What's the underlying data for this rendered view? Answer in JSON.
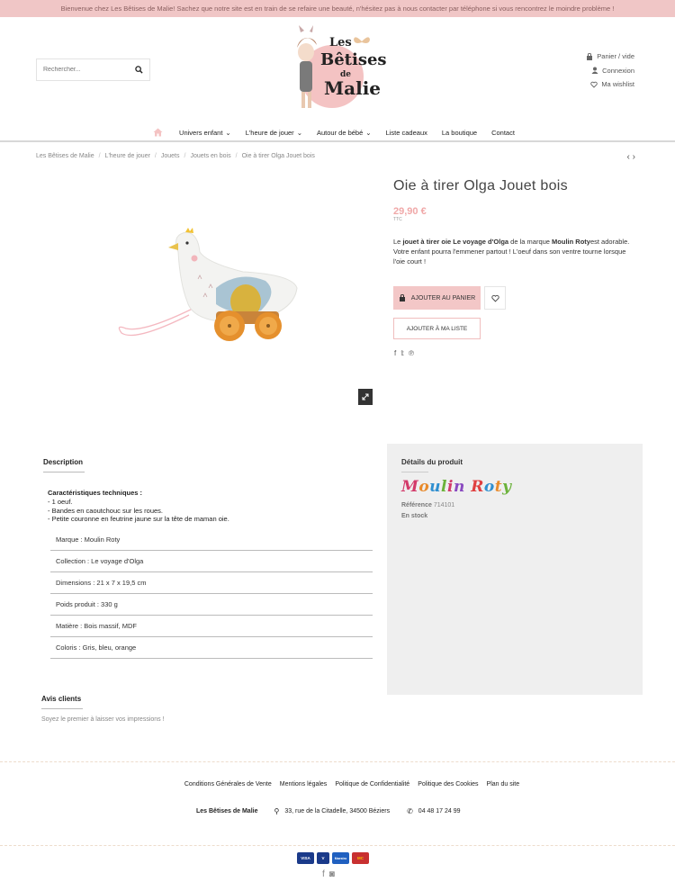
{
  "topbar": {
    "message": "Bienvenue chez Les Bêtises de Malie! Sachez que notre site est en train de se refaire une beauté, n'hésitez pas à nous contacter par téléphone si vous rencontrez le moindre problème !"
  },
  "search": {
    "placeholder": "Rechercher..."
  },
  "logo": {
    "line1": "Les",
    "line2": "Bêtises",
    "line3": "de",
    "line4": "Malie"
  },
  "account": {
    "cart": "Panier / vide",
    "login": "Connexion",
    "wishlist": "Ma wishlist"
  },
  "nav": {
    "items": [
      "Univers enfant",
      "L'heure de jouer",
      "Autour de bébé",
      "Liste cadeaux",
      "La boutique",
      "Contact"
    ]
  },
  "breadcrumb": [
    "Les Bêtises de Malie",
    "L'heure de jouer",
    "Jouets",
    "Jouets en bois",
    "Oie à tirer Olga Jouet bois"
  ],
  "pager": "‹ ›",
  "product": {
    "title": "Oie à tirer Olga Jouet bois",
    "price": "29,90 €",
    "tax": "TTC",
    "desc_1": "Le ",
    "desc_b1": "jouet à tirer oie Le voyage d'Olga",
    "desc_2": " de la marque ",
    "desc_b2": "Moulin Roty",
    "desc_3": "est adorable. Votre enfant pourra l'emmener partout ! L'oeuf dans son ventre tourne lorsque l'oie court !",
    "add_to_cart": "AJOUTER AU PANIER",
    "add_to_list": "AJOUTER À MA LISTE"
  },
  "description": {
    "tab": "Description",
    "tech_title": "Caractéristiques techniques :",
    "tech_lines": [
      "- 1 oeuf.",
      "- Bandes en caoutchouc sur les roues.",
      "- Petite couronne en feutrine jaune sur la tête de maman oie."
    ],
    "specs": [
      "Marque : Moulin Roty",
      "Collection : Le voyage d'Olga",
      "Dimensions : 21 x 7 x 19,5 cm",
      "Poids produit : 330 g",
      "Matière : Bois massif, MDF",
      "Coloris : Gris, bleu, orange"
    ]
  },
  "details": {
    "title": "Détails du produit",
    "brand_logo": "Moulin Roty",
    "ref_label": "Référence",
    "ref_value": "714101",
    "stock": "En stock"
  },
  "reviews": {
    "title": "Avis clients",
    "empty": "Soyez le premier à laisser vos impressions !"
  },
  "footer": {
    "links": [
      "Conditions Générales de Vente",
      "Mentions légales",
      "Politique de Confidentialité",
      "Politique des Cookies",
      "Plan du site"
    ],
    "shop": "Les Bêtises de Malie",
    "address": "33, rue de la Citadelle, 34500 Béziers",
    "phone": "04 48 17 24 99",
    "cards": [
      "VISA",
      "V",
      "Maestro",
      "MC"
    ]
  },
  "colors": {
    "topbar": "#f0c6c6",
    "accent": "#f3c7c7",
    "price": "#f0a8a8"
  }
}
